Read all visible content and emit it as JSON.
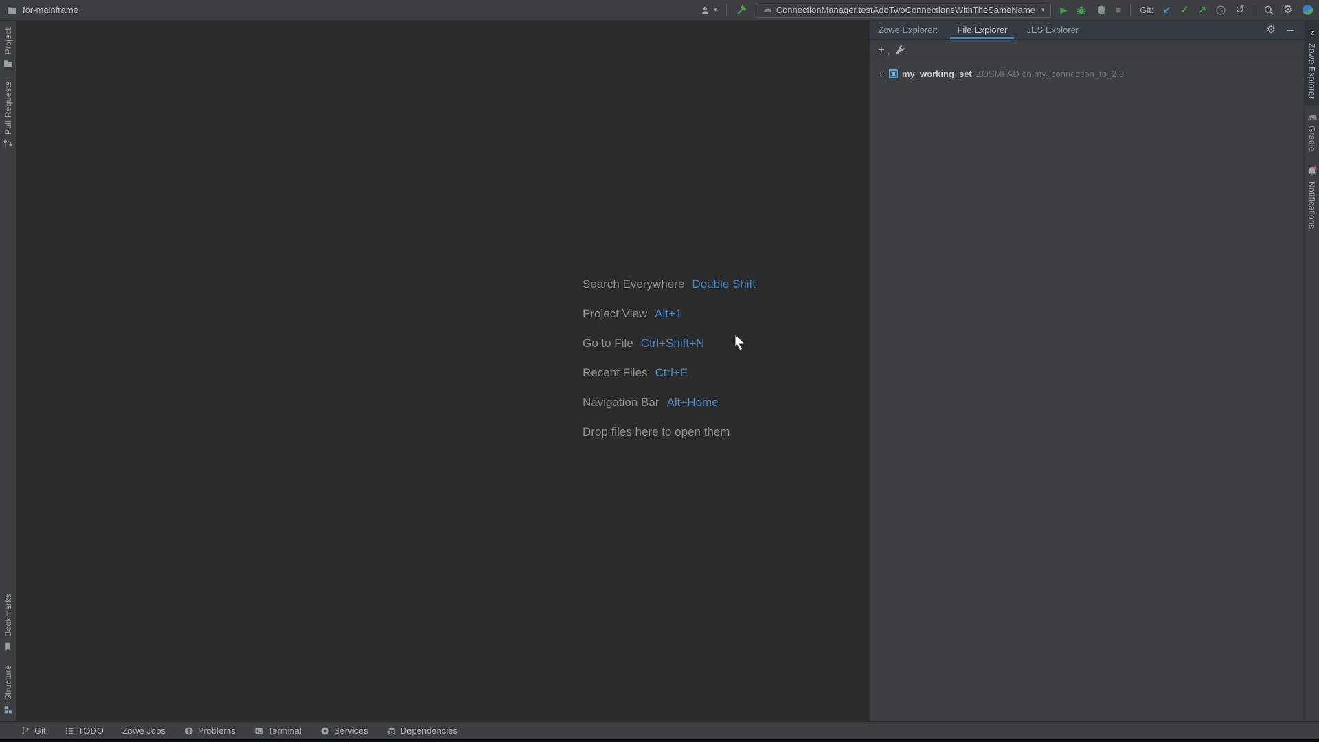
{
  "title_bar": {
    "project_name": "for-mainframe",
    "run_config": "ConnectionManager.testAddTwoConnectionsWithTheSameName",
    "git_label": "Git:"
  },
  "left_stripe": {
    "project": "Project",
    "pull_requests": "Pull Requests",
    "bookmarks": "Bookmarks",
    "structure": "Structure"
  },
  "right_stripe": {
    "zowe_explorer": "Zowe Explorer",
    "gradle": "Gradle",
    "notifications": "Notifications"
  },
  "editor": {
    "shortcuts": [
      {
        "label": "Search Everywhere",
        "keys": "Double Shift"
      },
      {
        "label": "Project View",
        "keys": "Alt+1"
      },
      {
        "label": "Go to File",
        "keys": "Ctrl+Shift+N"
      },
      {
        "label": "Recent Files",
        "keys": "Ctrl+E"
      },
      {
        "label": "Navigation Bar",
        "keys": "Alt+Home"
      }
    ],
    "drop_hint": "Drop files here to open them"
  },
  "zowe_panel": {
    "header_label": "Zowe Explorer:",
    "tabs": [
      {
        "label": "File Explorer"
      },
      {
        "label": "JES Explorer"
      }
    ],
    "tree_item": {
      "name": "my_working_set",
      "detail": "ZOSMFAD on my_connection_to_2.3"
    }
  },
  "status_bar": {
    "items": [
      "Git",
      "TODO",
      "Zowe Jobs",
      "Problems",
      "Terminal",
      "Services",
      "Dependencies"
    ]
  },
  "colors": {
    "accent_blue": "#4a87c7",
    "run_green": "#499c54",
    "git_update_blue": "#4193d6",
    "tab_underline": "#4a7eb0",
    "notification_red": "#e05555"
  }
}
